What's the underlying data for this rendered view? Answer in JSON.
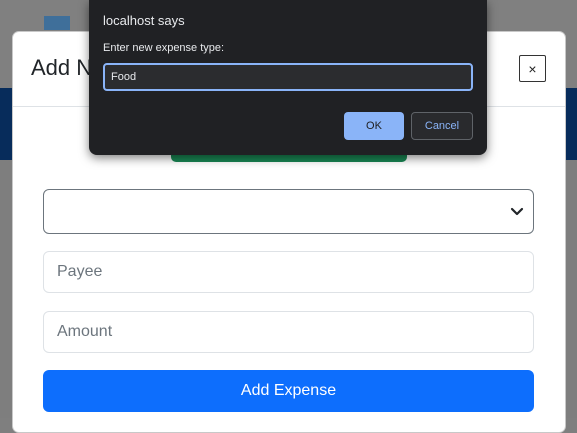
{
  "modal": {
    "title": "Add New Expense",
    "close_label": "×",
    "category_select": {
      "value": ""
    },
    "payee_input": {
      "placeholder": "Payee"
    },
    "amount_input": {
      "placeholder": "Amount"
    },
    "submit_label": "Add Expense"
  },
  "prompt": {
    "title": "localhost says",
    "message": "Enter new expense type:",
    "input_value": "Food",
    "ok_label": "OK",
    "cancel_label": "Cancel"
  },
  "colors": {
    "primary": "#0d6efd",
    "success": "#198754",
    "navy_band": "#072c5b",
    "dialog_bg": "#202124",
    "dialog_accent": "#8ab4f8"
  }
}
